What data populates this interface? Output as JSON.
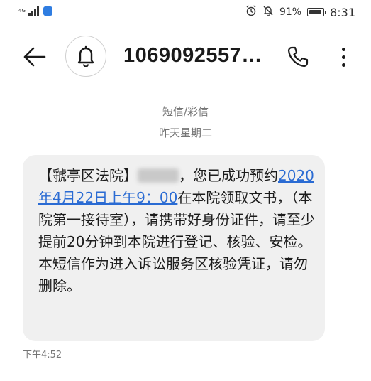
{
  "status_bar": {
    "network": "4G",
    "battery_percent": "91%",
    "time": "8:31",
    "icons": [
      "signal-icon",
      "app-notification-icon",
      "alarm-icon",
      "mute-icon",
      "battery-icon"
    ]
  },
  "header": {
    "contact_number": "1069092557…",
    "icons": [
      "back-arrow-icon",
      "bell-icon",
      "phone-icon",
      "more-vert-icon"
    ]
  },
  "conversation": {
    "message_type": "短信/彩信",
    "day_label": "昨天星期二"
  },
  "message": {
    "sender_tag": "【虢亭区法院】",
    "after_redaction": "，您已成功预约",
    "date_link": "2020年4月22日上午9：00",
    "body": "在本院领取文书，（本院第一接待室），请携带好身份证件，请至少提前20分钟到本院进行登记、核验、安检。本短信作为进入诉讼服务区核验凭证，请勿删除。",
    "time": "下午4:52"
  },
  "colors": {
    "link": "#2a6bd3",
    "bubble": "#f0f0f0",
    "meta_text": "#757575"
  }
}
